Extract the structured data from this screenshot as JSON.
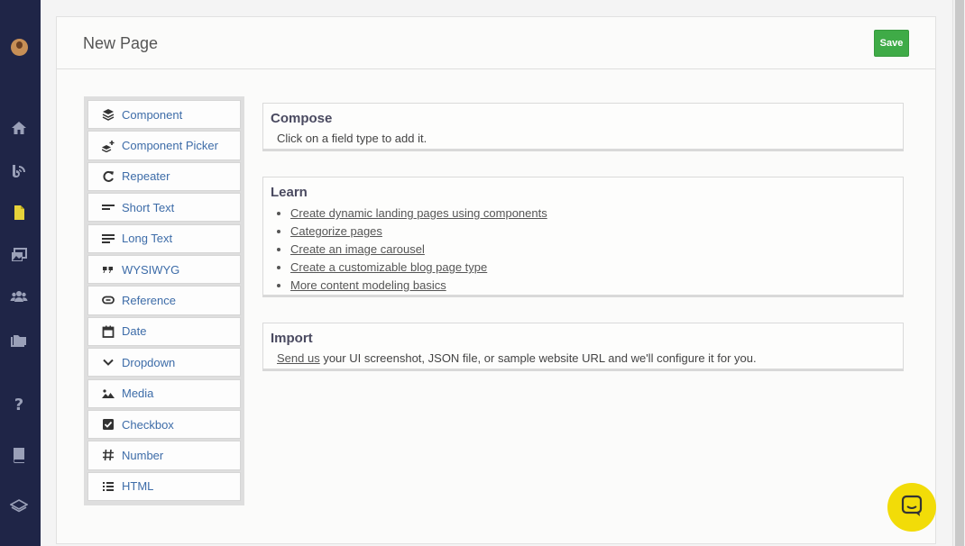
{
  "header": {
    "title": "New Page",
    "save_label": "Save"
  },
  "sidebar": {
    "icons": [
      "avatar",
      "home-icon",
      "blog-icon",
      "page-icon",
      "media-icon",
      "users-icon",
      "folder-icon",
      "help-icon",
      "book-icon",
      "layers-icon"
    ]
  },
  "field_types": [
    {
      "label": "Component",
      "icon": "layers-icon"
    },
    {
      "label": "Component Picker",
      "icon": "layers-plus-icon"
    },
    {
      "label": "Repeater",
      "icon": "repeat-icon"
    },
    {
      "label": "Short Text",
      "icon": "short-text-icon"
    },
    {
      "label": "Long Text",
      "icon": "long-text-icon"
    },
    {
      "label": "WYSIWYG",
      "icon": "quote-icon"
    },
    {
      "label": "Reference",
      "icon": "link-icon"
    },
    {
      "label": "Date",
      "icon": "calendar-icon"
    },
    {
      "label": "Dropdown",
      "icon": "chevron-down-icon"
    },
    {
      "label": "Media",
      "icon": "image-icon"
    },
    {
      "label": "Checkbox",
      "icon": "checkbox-icon"
    },
    {
      "label": "Number",
      "icon": "hash-icon"
    },
    {
      "label": "HTML",
      "icon": "list-icon"
    }
  ],
  "compose": {
    "title": "Compose",
    "text": "Click on a field type to add it."
  },
  "learn": {
    "title": "Learn",
    "links": [
      "Create dynamic landing pages using components",
      "Categorize pages",
      "Create an image carousel",
      "Create a customizable blog page type",
      "More content modeling basics"
    ]
  },
  "import": {
    "title": "Import",
    "link": "Send us",
    "text": " your UI screenshot, JSON file, or sample website URL and we'll configure it for you."
  },
  "colors": {
    "sidebar": "#1f2547",
    "accent_link": "#3d6ca8",
    "save": "#3fab47",
    "chat": "#f2dc08"
  }
}
